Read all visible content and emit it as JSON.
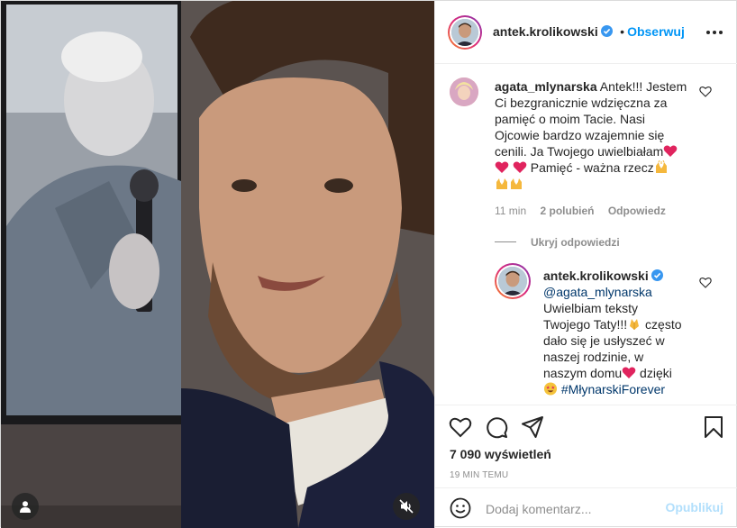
{
  "post": {
    "author": "antek.krolikowski",
    "separator": "•",
    "follow_label": "Obserwuj"
  },
  "comments": [
    {
      "username": "agata_mlynarska",
      "lines": [
        "Antek!!! Jestem",
        "Ci bezgranicznie wdzięczna za",
        "pamięć o moim Tacie. Nasi",
        "Ojcowie bardzo wzajemnie się",
        "cenili. Ja Twojego uwielbiałam",
        " Pamięć - ważna rzecz"
      ],
      "time": "11 min",
      "likes": "2 polubień",
      "reply_label": "Odpowiedz",
      "hide_replies_label": "Ukryj odpowiedzi"
    },
    {
      "username": "antek.krolikowski",
      "mention": "@agata_mlynarska",
      "lines": [
        "Uwielbiam teksty",
        "Twojego Taty!!!",
        " często",
        "dało się je usłyszeć w",
        "naszej rodzinie, w",
        "naszym domu",
        " dzięki"
      ],
      "hashtag": "#MłynarskiForever"
    }
  ],
  "stats": {
    "views": "7 090 wyświetleń",
    "timestamp": "19 MIN TEMU"
  },
  "composer": {
    "placeholder": "Dodaj komentarz...",
    "post_label": "Opublikuj"
  },
  "colors": {
    "accent": "#0095f6",
    "link": "#00376b",
    "muted": "#8e8e8e",
    "emoji_heart": "#e0245e",
    "emoji_hands": "#f5b83d",
    "verified": "#3897f0"
  },
  "icons": [
    "verified-badge-icon",
    "more-options-icon",
    "heart-icon",
    "comment-icon",
    "share-icon",
    "bookmark-icon",
    "emoji-icon",
    "user-tag-icon",
    "speaker-muted-icon",
    "red-heart-emoji",
    "raising-hands-emoji",
    "folded-hands-emoji",
    "star-struck-emoji"
  ]
}
